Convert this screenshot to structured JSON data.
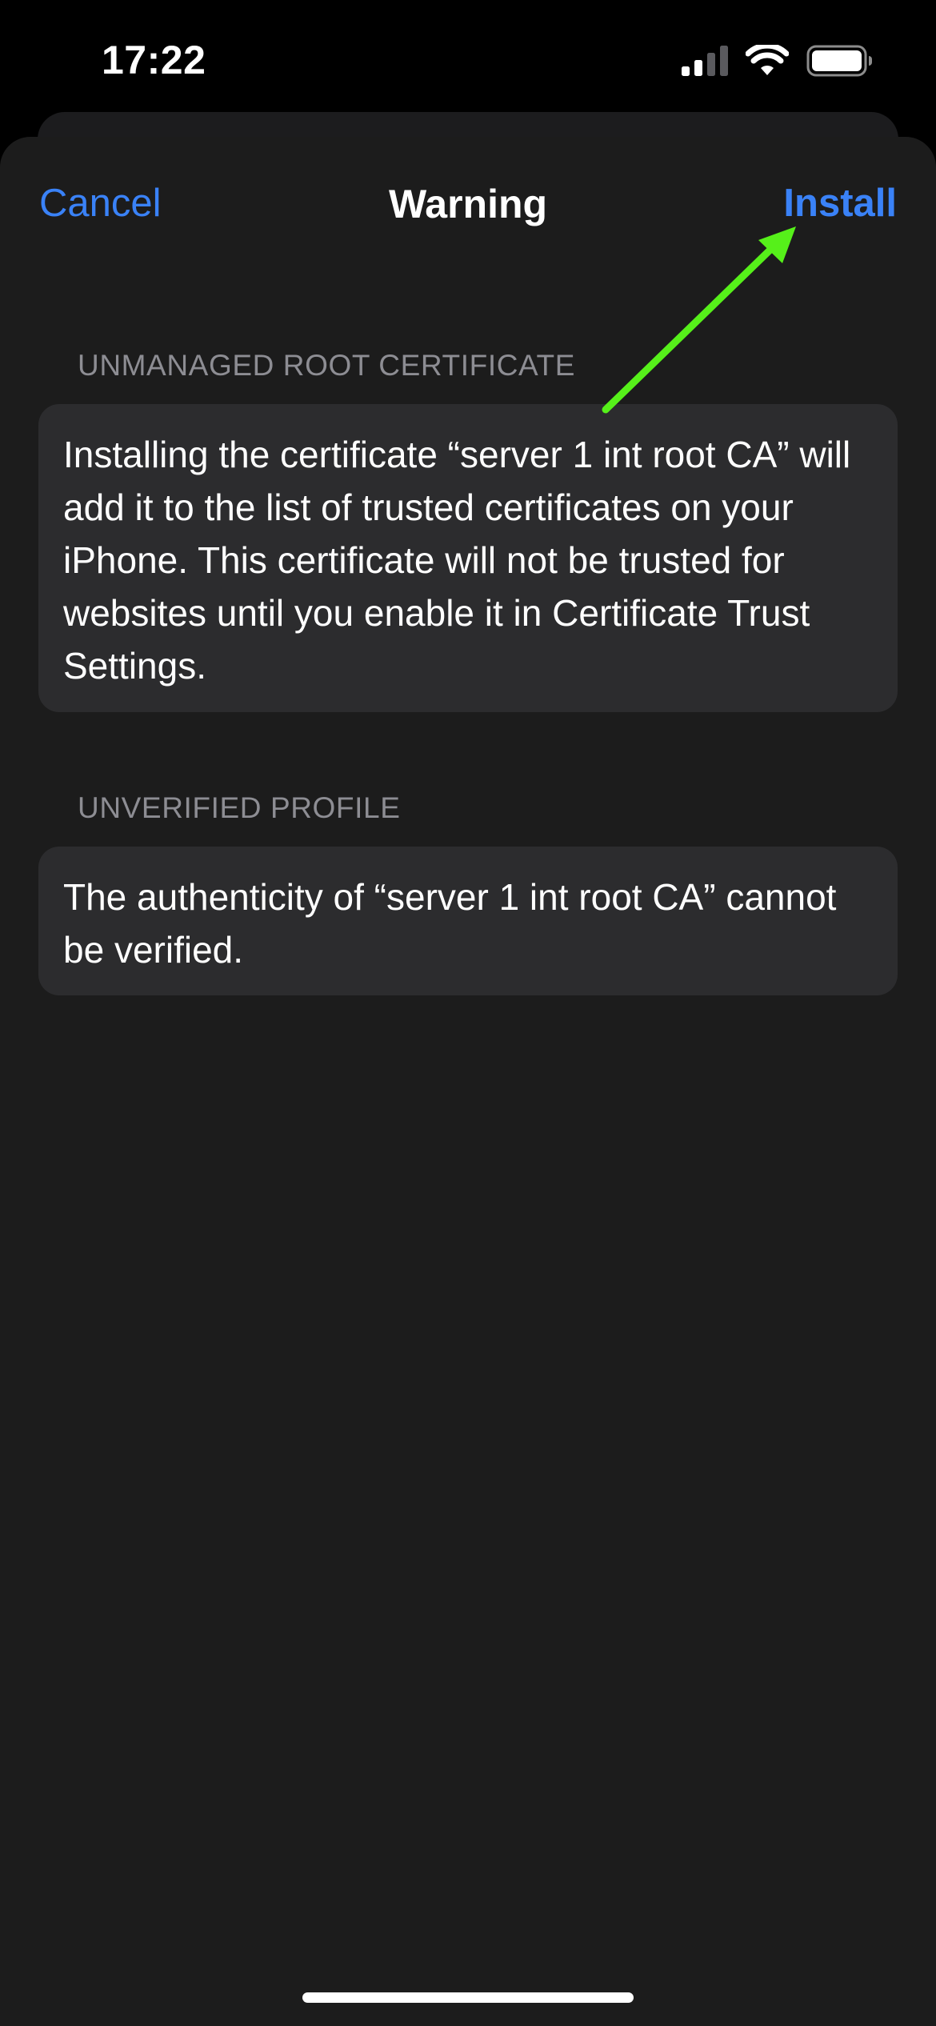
{
  "status_bar": {
    "time": "17:22",
    "icons": [
      "cellular-signal-icon",
      "wifi-icon",
      "battery-icon"
    ]
  },
  "nav": {
    "cancel_label": "Cancel",
    "title": "Warning",
    "install_label": "Install"
  },
  "sections": [
    {
      "header": "UNMANAGED ROOT CERTIFICATE",
      "body": "Installing the certificate “server 1 int root CA” will add it to the list of trusted certificates on your iPhone. This certificate will not be trusted for websites until you enable it in Certificate Trust Settings."
    },
    {
      "header": "UNVERIFIED PROFILE",
      "body": "The authenticity of “server 1 int root CA” cannot be verified."
    }
  ],
  "colors": {
    "background": "#000000",
    "sheet": "#1c1c1c",
    "card": "#2c2c2e",
    "accent": "#3a82f7",
    "header_text": "#8d8d93",
    "annotation_arrow": "#56f01a"
  }
}
